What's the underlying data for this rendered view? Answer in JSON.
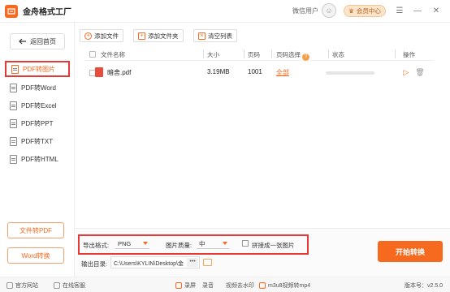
{
  "app": {
    "title": "金舟格式工厂"
  },
  "user": {
    "name": "微信用户",
    "vip_label": "会员中心"
  },
  "sidebar": {
    "back_label": "返回首页",
    "items": [
      {
        "label": "PDF转图片",
        "active": true
      },
      {
        "label": "PDF转Word"
      },
      {
        "label": "PDF转Excel"
      },
      {
        "label": "PDF转PPT"
      },
      {
        "label": "PDF转TXT"
      },
      {
        "label": "PDF转HTML"
      }
    ],
    "buttons": [
      {
        "label": "文件转PDF"
      },
      {
        "label": "Word转换"
      }
    ]
  },
  "toolbar": {
    "add_file": "添加文件",
    "add_folder": "添加文件夹",
    "clear_list": "清空列表"
  },
  "table": {
    "headers": {
      "name": "文件名称",
      "size": "大小",
      "pages": "页码",
      "page_select": "页码选择",
      "badge": "?",
      "status": "状态",
      "action": "操作"
    },
    "rows": [
      {
        "name": "暗舍.pdf",
        "size": "3.19MB",
        "pages": "1001",
        "page_select": "全部",
        "progress": 0
      }
    ]
  },
  "options": {
    "export_format_label": "导出格式:",
    "export_format_value": "PNG",
    "quality_label": "图片质量:",
    "quality_value": "中",
    "merge_label": "拼接成一张图片",
    "output_label": "输出目录:",
    "output_path": "C:\\Users\\KYLIN\\Desktop\\金",
    "more": "•••",
    "start_label": "开始转换"
  },
  "footer": {
    "website": "官方网站",
    "support": "在线客服",
    "record": "录屏",
    "record2": "录音",
    "watermark": "视频去水印",
    "m3u8": "m3u8视频转mp4",
    "version": "版本号：v2.5.0"
  },
  "colors": {
    "accent": "#f56a1e",
    "annotation": "#e53935"
  }
}
